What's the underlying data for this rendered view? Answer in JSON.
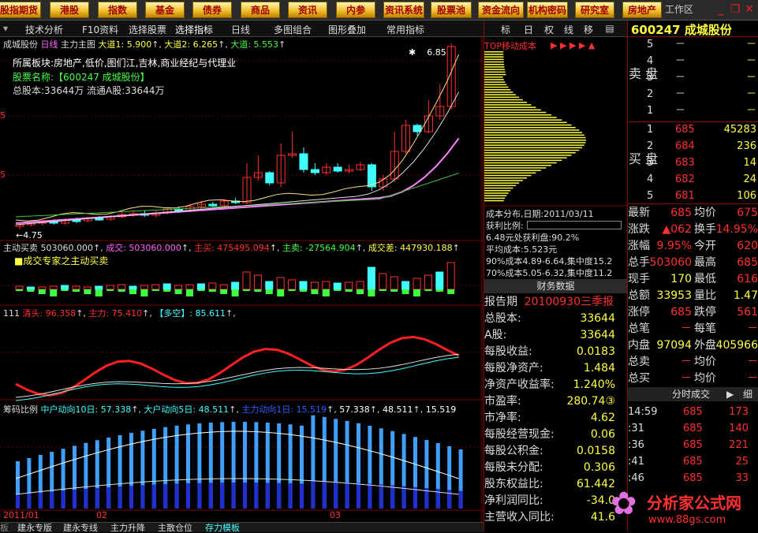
{
  "nav": [
    "股指期货",
    "港股",
    "指数",
    "基金",
    "债券",
    "商品",
    "资讯",
    "内参",
    "资讯系统",
    "股票池",
    "资金流向",
    "机构密码",
    "研究室",
    "房地产"
  ],
  "window_title": "工作区",
  "toolbar": [
    "技术分析",
    "F10资料",
    "选择股票",
    "选择指标",
    "日线",
    "多图组合",
    "图形叠加",
    "常用指标"
  ],
  "right_tools": [
    "标",
    "日",
    "权",
    "线",
    "移"
  ],
  "stock": {
    "code": "600247",
    "name": "成城股份"
  },
  "main_chart": {
    "title": "成城股份",
    "period": "日线",
    "indicator": "主力主图",
    "ma1": "大道1: 5.900",
    "ma2": "大道2: 6.265",
    "ma3": "大道: 5.553",
    "info1": "所属板块:房地产,低价,图们江,吉林,商业经纪与代理业",
    "info2": "股票名称:【600247 成城股份】",
    "info3": "总股本:33644万   流通A股:33644万",
    "high_label": "6.85",
    "low_label": "4.75"
  },
  "sub1": {
    "name": "主动买卖",
    "v1": "503060.000",
    "v2": "成交: 503060.000",
    "v3": "主买: 475495.094",
    "v4": "主卖: -27564.904",
    "v5": "成交差: 447930.188",
    "legend": "成交专家之主动买卖"
  },
  "sub2": {
    "name": "111",
    "v1": "清头: 96.358",
    "v2": "主力: 75.410",
    "v3": "【多空】: 85.611"
  },
  "sub3": {
    "name": "筹码比例",
    "v1": "中户动向10日: 57.338",
    "v2": "大户动向5日: 48.511",
    "v3": "主力动向1日: 15.519",
    "v4": "57.338",
    "v5": "48.511",
    "v6": "15.519"
  },
  "dates": [
    "2011/01",
    "02",
    "03"
  ],
  "cost": {
    "title": "TOP移动成本",
    "line1": "成本分布,日期:2011/03/11",
    "line2": "获利比例:",
    "line3": "6.48元处获利盘:90.2%",
    "line4": "平均成本:5.523元",
    "line5": "90%成本4.89-6.64,集中度15.2",
    "line6": "70%成本5.05-6.32,集中度11.2"
  },
  "finance": {
    "title": "财务数据",
    "rows": [
      {
        "label": "报告期",
        "value": "20100930三季报"
      },
      {
        "label": "总股本:",
        "value": "33644"
      },
      {
        "label": "A股:",
        "value": "33644"
      },
      {
        "label": "每股收益:",
        "value": "0.0183"
      },
      {
        "label": "每股净资产:",
        "value": "1.484"
      },
      {
        "label": "净资产收益率:",
        "value": "1.240%"
      },
      {
        "label": "市盈率:",
        "value": "280.74③"
      },
      {
        "label": "市净率:",
        "value": "4.62"
      },
      {
        "label": "每股经营现金:",
        "value": "0.06"
      },
      {
        "label": "每股公积金:",
        "value": "0.0158"
      },
      {
        "label": "每股未分配:",
        "value": "0.306"
      },
      {
        "label": "股东权益比:",
        "value": "61.442"
      },
      {
        "label": "净利润同比:",
        "value": "-34.0"
      },
      {
        "label": "主营收入同比:",
        "value": "41.6"
      }
    ]
  },
  "orderbook": {
    "sell_label": "卖 盘",
    "buy_label": "买 盘",
    "sell": [
      {
        "n": "5",
        "p": "－",
        "v": "－"
      },
      {
        "n": "4",
        "p": "－",
        "v": "－"
      },
      {
        "n": "3",
        "p": "－",
        "v": "－"
      },
      {
        "n": "2",
        "p": "－",
        "v": "－"
      },
      {
        "n": "1",
        "p": "－",
        "v": "－"
      }
    ],
    "buy": [
      {
        "n": "1",
        "p": "685",
        "v": "45283"
      },
      {
        "n": "2",
        "p": "684",
        "v": "236"
      },
      {
        "n": "3",
        "p": "683",
        "v": "14"
      },
      {
        "n": "4",
        "p": "682",
        "v": "24"
      },
      {
        "n": "5",
        "p": "681",
        "v": "106"
      }
    ]
  },
  "quote": [
    {
      "l1": "最新",
      "v1": "685",
      "l2": "均价",
      "v2": "675"
    },
    {
      "l1": "涨跌",
      "v1": "▲062",
      "l2": "换手",
      "v2": "14.95%"
    },
    {
      "l1": "涨幅",
      "v1": "9.95%",
      "l2": "今开",
      "v2": "620"
    },
    {
      "l1": "总手",
      "v1": "503060",
      "l2": "最高",
      "v2": "685"
    },
    {
      "l1": "现手",
      "v1": "170",
      "l2": "最低",
      "v2": "616"
    },
    {
      "l1": "总额",
      "v1": "33953",
      "l2": "量比",
      "v2": "1.47"
    },
    {
      "l1": "涨停",
      "v1": "685",
      "l2": "跌停",
      "v2": "561"
    },
    {
      "l1": "总笔",
      "v1": "－",
      "l2": "每笔",
      "v2": "－"
    },
    {
      "l1": "内盘",
      "v1": "97094",
      "l2": "外盘",
      "v2": "405966"
    },
    {
      "l1": "总卖",
      "v1": "－",
      "l2": "均价",
      "v2": "－"
    },
    {
      "l1": "总买",
      "v1": "－",
      "l2": "均价",
      "v2": "－"
    }
  ],
  "ticks_title": "分时成交",
  "ticks_btn": "细",
  "ticks": [
    {
      "t": "14:59",
      "p": "685",
      "v": "173"
    },
    {
      "t": ":31",
      "p": "685",
      "v": "140"
    },
    {
      "t": ":36",
      "p": "685",
      "v": "221"
    },
    {
      "t": ":41",
      "p": "685",
      "v": "25"
    },
    {
      "t": ":46",
      "p": "685",
      "v": "33"
    }
  ],
  "bottom_tabs": [
    "建永专版",
    "建永专线",
    "主力升降",
    "主散仓位",
    "存力模板"
  ],
  "logo": {
    "brand": "分析家公式网",
    "url": "www.88gs.com"
  },
  "colors": {
    "up": "#ff3030",
    "down": "#40ffff",
    "yellow": "#ffff40",
    "magenta": "#ff60ff",
    "green": "#40c040",
    "blue": "#3080ff"
  }
}
